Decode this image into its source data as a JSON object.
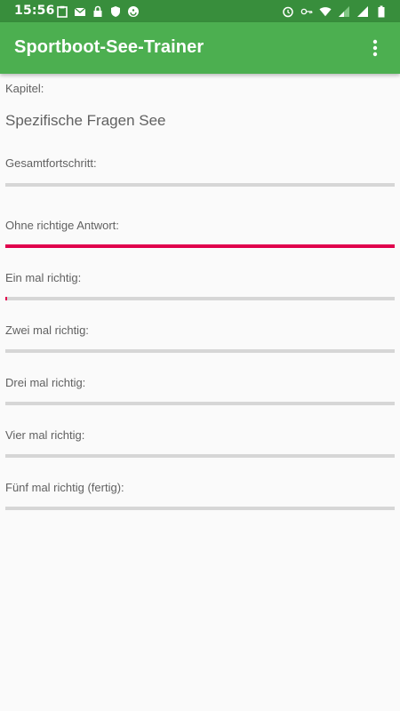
{
  "status_bar": {
    "time": "15:56",
    "left_icons": [
      "clipboard-icon",
      "mail-icon",
      "lock-icon",
      "shield-icon",
      "sync-icon"
    ],
    "right_icons": [
      "alarm-icon",
      "key-icon",
      "wifi-icon",
      "signal-icon",
      "signal-icon",
      "battery-icon"
    ]
  },
  "app_bar": {
    "title": "Sportboot-See-Trainer",
    "menu_icon": "more-vert-icon"
  },
  "chapter": {
    "label": "Kapitel:",
    "value": "Spezifische Fragen See"
  },
  "progress": [
    {
      "label": "Gesamtfortschritt:",
      "value": 0
    },
    {
      "label": "Ohne richtige Antwort:",
      "value": 1.0
    },
    {
      "label": "Ein mal richtig:",
      "value": 0.005
    },
    {
      "label": "Zwei mal richtig:",
      "value": 0
    },
    {
      "label": "Drei mal richtig:",
      "value": 0
    },
    {
      "label": "Vier mal richtig:",
      "value": 0
    },
    {
      "label": "Fünf mal richtig (fertig):",
      "value": 0
    }
  ],
  "colors": {
    "status_bar": "#388e3c",
    "app_bar": "#4caf50",
    "progress_fill": "#e0004d",
    "progress_track": "#d6d6d6"
  }
}
